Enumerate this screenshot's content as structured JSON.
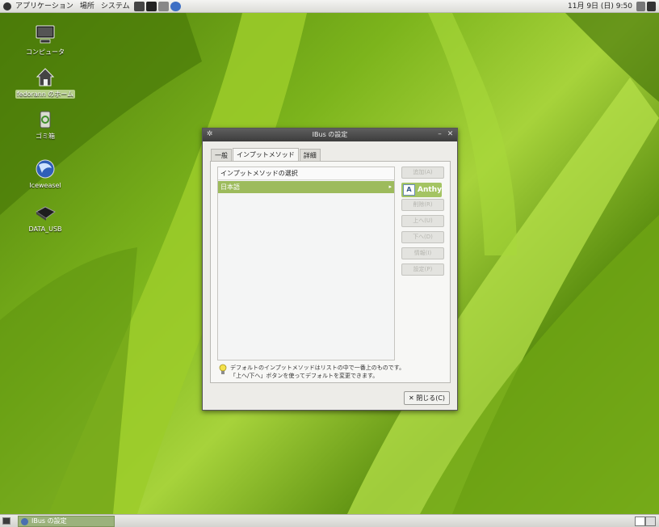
{
  "top_panel": {
    "menus": [
      "アプリケーション",
      "場所",
      "システム"
    ],
    "clock": "11月 9日 (日)  9:50"
  },
  "desktop_icons": [
    {
      "label": "コンピュータ",
      "icon": "computer-icon"
    },
    {
      "label": "fedorann のホーム",
      "icon": "home-folder-icon"
    },
    {
      "label": "ゴミ箱",
      "icon": "trash-icon"
    },
    {
      "label": "Iceweasel",
      "icon": "iceweasel-browser-icon"
    },
    {
      "label": "DATA_USB",
      "icon": "usb-drive-icon"
    }
  ],
  "dialog": {
    "title": "IBus の設定",
    "tabs": [
      "一般",
      "インプットメソッド",
      "詳細"
    ],
    "active_tab": "インプットメソッド",
    "list_header": "インプットメソッドの選択",
    "selected_item": "日本語",
    "side_buttons": [
      "追加(A)",
      "削除(R)",
      "上へ(U)",
      "下へ(D)",
      "情報(I)",
      "設定(P)"
    ],
    "popup_engine": "Anthy",
    "hint_line1": "デフォルトのインプットメソッドはリストの中で一番上のものです。",
    "hint_line2": "「上へ/下へ」ボタンを使ってデフォルトを変更できます。",
    "close_label": "閉じる(C)"
  },
  "bottom_panel": {
    "task_label": "IBus の設定"
  },
  "colors": {
    "accent_green": "#9dbb5c",
    "titlebar": "#4a4a4a",
    "wallpaper": "#7cb41c"
  }
}
